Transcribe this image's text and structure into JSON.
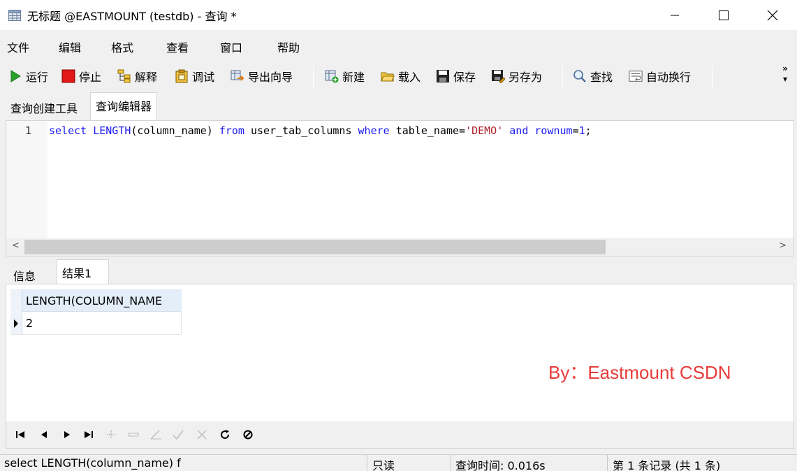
{
  "window": {
    "title": "无标题 @EASTMOUNT (testdb) - 查询 *"
  },
  "menu": [
    "文件",
    "编辑",
    "格式",
    "查看",
    "窗口",
    "帮助"
  ],
  "toolbar": {
    "run": "运行",
    "stop": "停止",
    "explain": "解释",
    "debug": "调试",
    "export_wizard": "导出向导",
    "new": "新建",
    "load": "载入",
    "save": "保存",
    "save_as": "另存为",
    "find": "查找",
    "word_wrap": "自动换行",
    "more": "»"
  },
  "editor_tabs": [
    "查询创建工具",
    "查询编辑器"
  ],
  "editor": {
    "line_number": "1",
    "tokens": [
      {
        "t": "select",
        "c": "kw"
      },
      {
        "t": " ",
        "c": "plain"
      },
      {
        "t": "LENGTH",
        "c": "kw"
      },
      {
        "t": "(column_name) ",
        "c": "plain"
      },
      {
        "t": "from",
        "c": "kw"
      },
      {
        "t": " user_tab_columns ",
        "c": "plain"
      },
      {
        "t": "where",
        "c": "kw"
      },
      {
        "t": " table_name=",
        "c": "plain"
      },
      {
        "t": "'DEMO'",
        "c": "str"
      },
      {
        "t": " ",
        "c": "plain"
      },
      {
        "t": "and",
        "c": "kw"
      },
      {
        "t": " ",
        "c": "plain"
      },
      {
        "t": "rownum",
        "c": "kw"
      },
      {
        "t": "=",
        "c": "plain"
      },
      {
        "t": "1",
        "c": "kw"
      },
      {
        "t": ";",
        "c": "plain"
      }
    ]
  },
  "result_tabs": [
    "信息",
    "结果1"
  ],
  "results": {
    "column": "LENGTH(COLUMN_NAME",
    "rows": [
      "2"
    ]
  },
  "watermark": "By：Eastmount CSDN",
  "status": {
    "sql": "select LENGTH(column_name) f",
    "mode": "只读",
    "query_time": "查询时间: 0.016s",
    "record": "第 1 条记录 (共 1 条)"
  },
  "colors": {
    "keyword": "#1a1af0",
    "string": "#b0202a",
    "watermark": "#e83b3b"
  }
}
